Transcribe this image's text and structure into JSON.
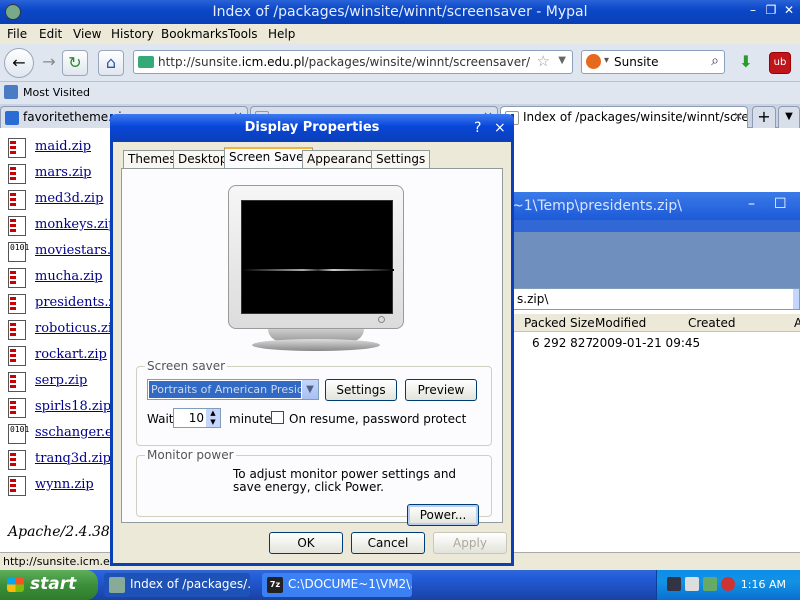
{
  "browser": {
    "title": "Index of /packages/winsite/winnt/screensaver - Mypal",
    "menu": [
      "File",
      "Edit",
      "View",
      "History",
      "Bookmarks",
      "Tools",
      "Help"
    ],
    "url_prefix": "http://sunsite.",
    "url_domain": "icm.edu.pl",
    "url_path": "/packages/winsite/winnt/screensaver/",
    "search_engine": "Sunsite",
    "bookmark_most_visited": "Most Visited",
    "tabs": [
      {
        "label": "favoritetheme.zip"
      },
      {
        "label": "Index of /packages/winsite/winnt/screen..."
      }
    ],
    "new_tab_glyph": "+",
    "tab_close_glyph": "×",
    "status_text": "http://sunsite.icm.edu"
  },
  "page": {
    "files": [
      {
        "name": "maid.zip",
        "type": "zip"
      },
      {
        "name": "mars.zip",
        "type": "zip"
      },
      {
        "name": "med3d.zip",
        "type": "zip"
      },
      {
        "name": "monkeys.zip",
        "type": "zip"
      },
      {
        "name": "moviestars.e",
        "type": "bin"
      },
      {
        "name": "mucha.zip",
        "type": "zip"
      },
      {
        "name": "presidents.zi",
        "type": "zip"
      },
      {
        "name": "roboticus.zip",
        "type": "zip"
      },
      {
        "name": "rockart.zip",
        "type": "zip"
      },
      {
        "name": "serp.zip",
        "type": "zip"
      },
      {
        "name": "spirls18.zip",
        "type": "zip"
      },
      {
        "name": "sschanger.ex",
        "type": "bin"
      },
      {
        "name": "tranq3d.zip",
        "type": "zip"
      },
      {
        "name": "wynn.zip",
        "type": "zip"
      }
    ],
    "server_signature": "Apache/2.4.38 ("
  },
  "explorer": {
    "title": "~1\\Temp\\presidents.zip\\",
    "address": "s.zip\\",
    "columns": [
      "Packed Size",
      "Modified",
      "Created",
      "A"
    ],
    "row": {
      "packed_size": "6 292 827",
      "modified": "2009-01-21 09:45"
    }
  },
  "dialog": {
    "title": "Display Properties",
    "help_glyph": "?",
    "close_glyph": "×",
    "tabs": [
      "Themes",
      "Desktop",
      "Screen Saver",
      "Appearance",
      "Settings"
    ],
    "selected_tab": "Screen Saver",
    "screensaver_group": "Screen saver",
    "screensaver_value": "Portraits of American Presidents",
    "settings_label": "Settings",
    "preview_label": "Preview",
    "wait_label": "Wait:",
    "wait_value": "10",
    "minutes_label": "minutes",
    "resume_label": "On resume, password protect",
    "resume_checked": false,
    "monitor_group": "Monitor power",
    "monitor_text": "To adjust monitor power settings and save energy, click Power.",
    "power_label": "Power...",
    "ok_label": "OK",
    "cancel_label": "Cancel",
    "apply_label": "Apply"
  },
  "taskbar": {
    "start_label": "start",
    "tasks": [
      {
        "label": "Index of /packages/..."
      },
      {
        "label": "C:\\DOCUME~1\\VM2\\..."
      }
    ],
    "clock": "1:16 AM"
  },
  "colors": {
    "xp_blue": "#0a3fb5",
    "link": "#00008b",
    "selection": "#316ac5",
    "start_green": "#3c8f3a"
  }
}
